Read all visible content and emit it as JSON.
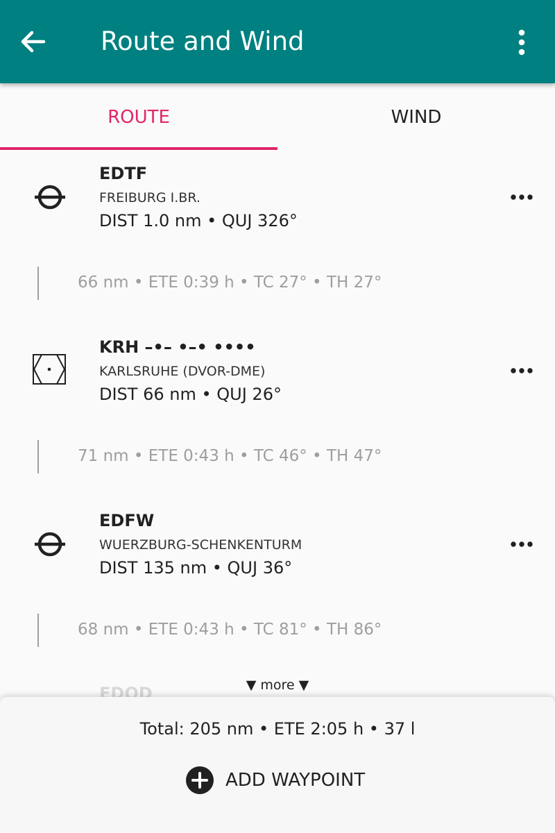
{
  "app_bar": {
    "title": "Route and Wind",
    "back_icon": "arrow-back-icon",
    "menu_icon": "more-vertical-icon",
    "background_color": "#008080"
  },
  "tabs": [
    {
      "label": "ROUTE",
      "selected": true
    },
    {
      "label": "WIND",
      "selected": false
    }
  ],
  "accent_color": "#e0256a",
  "waypoints": [
    {
      "code": "EDTF",
      "name": "FREIBURG I.BR.",
      "dist": "DIST 1.0 nm • QUJ 326°",
      "icon": "airport-icon"
    },
    {
      "code": "KRH –•– •–• ••••",
      "name": "KARLSRUHE (DVOR-DME)",
      "dist": "DIST 66 nm • QUJ 26°",
      "icon": "vor-dme-icon"
    },
    {
      "code": "EDFW",
      "name": "WUERZBURG-SCHENKENTURM",
      "dist": "DIST 135 nm • QUJ 36°",
      "icon": "airport-icon"
    }
  ],
  "legs": [
    {
      "text": "66 nm • ETE 0:39 h • TC 27° • TH 27°"
    },
    {
      "text": "71 nm • ETE 0:43 h • TC 46° • TH 47°"
    },
    {
      "text": "68 nm • ETE 0:43 h • TC 81° • TH 86°"
    }
  ],
  "partial_waypoint_code": "EDQD",
  "more_indicator": "▼ more ▼",
  "summary": {
    "total": "Total: 205 nm • ETE 2:05 h • 37 l",
    "add_waypoint_label": "ADD WAYPOINT"
  }
}
